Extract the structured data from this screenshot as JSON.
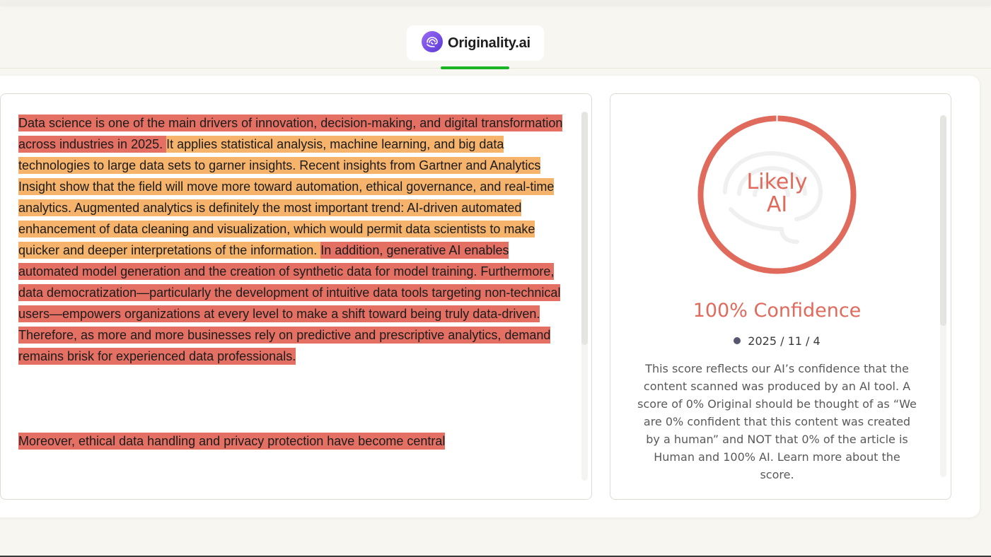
{
  "tab": {
    "label": "Originality.ai",
    "icon": "brain-logo-icon"
  },
  "text_panel": {
    "paragraph1": [
      {
        "text": " Data science is one of the main drivers of innovation, decision-making, and digital transformation across industries in 2025. ",
        "highlight": "red"
      },
      {
        "text": " It applies statistical analysis, machine learning, and big data technologies to large data sets to garner insights.  Recent insights from Gartner and Analytics Insight show that the field will move more toward automation, ethical governance, and real-time analytics.  Augmented analytics is definitely the most important trend: AI-driven automated enhancement of data cleaning and visualization, which would permit data scientists to make quicker and deeper interpretations of the information. ",
        "highlight": "orange"
      },
      {
        "text": " In addition, generative AI enables automated model generation and the creation of synthetic data for model training.  Furthermore, data democratization—particularly the development of intuitive data tools targeting non-technical users—empowers organizations at every level to make a shift toward being truly data-driven.  Therefore, as more and more businesses rely on predictive and prescriptive analytics, demand remains brisk for experienced data professionals. ",
        "highlight": "red"
      }
    ],
    "paragraph2": " Moreover, ethical data handling and privacy protection have become central"
  },
  "result": {
    "gauge_label": "Likely AI",
    "gauge_fraction": 1.0,
    "confidence": "100% Confidence",
    "date": "2025 / 11 / 4",
    "description": "This score reflects our AI’s confidence that the content scanned was produced by an AI tool. A score of 0% Original should be thought of as “We are 0% confident that this content was created by a human” and NOT that 0% of the article is Human and 100% AI. Learn more about the score."
  },
  "colors": {
    "ai_red": "#e06a5b",
    "highlight_red": "#e46f63",
    "highlight_orange": "#f5b36b",
    "tab_underline": "#18b424",
    "logo_purple": "#7b4fe6"
  }
}
